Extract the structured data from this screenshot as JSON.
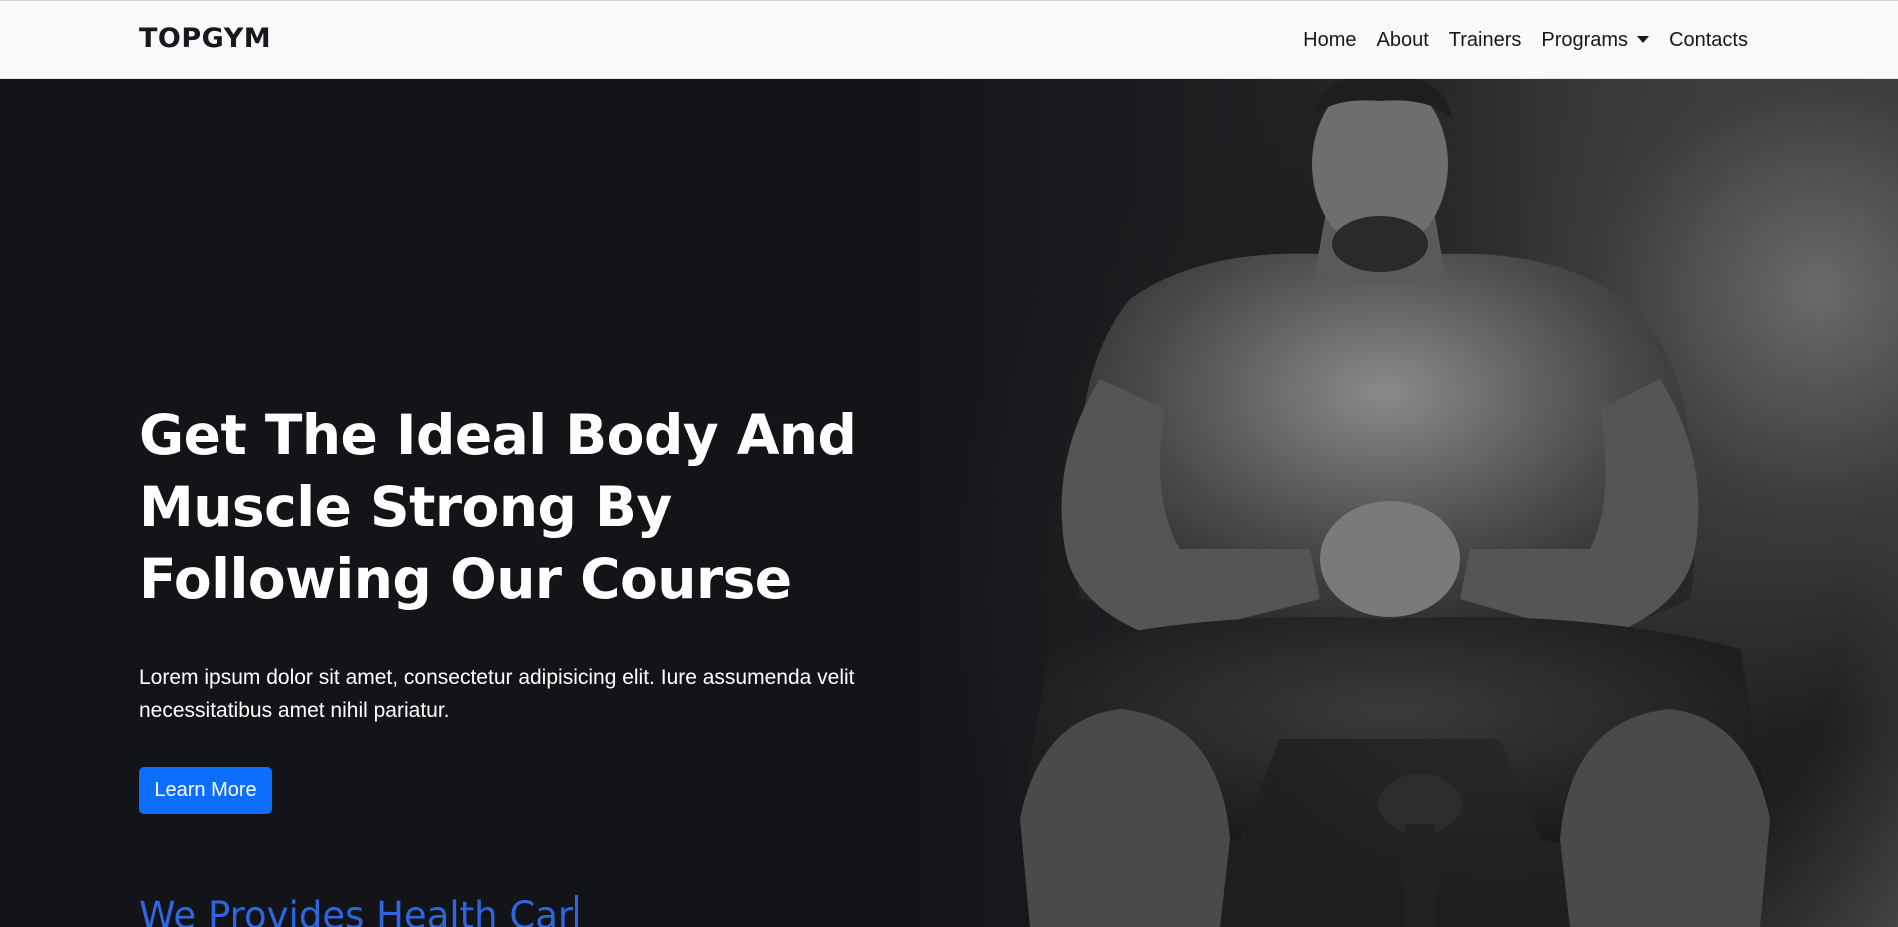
{
  "navbar": {
    "brand": "TOPGYM",
    "links": [
      {
        "label": "Home"
      },
      {
        "label": "About"
      },
      {
        "label": "Trainers"
      },
      {
        "label": "Programs",
        "dropdown": true
      },
      {
        "label": "Contacts"
      }
    ]
  },
  "hero": {
    "headline": "Get The Ideal Body And Muscle Strong By Following Our Course",
    "lead": "Lorem ipsum dolor sit amet, consectetur adipisicing elit. Iure assumenda velit necessitatibus amet nihil pariatur.",
    "button_label": "Learn More",
    "typing_text": "We Provides Health Car",
    "image_subject": "muscular man seated, hands clasped, black and white"
  },
  "colors": {
    "navbar_bg": "#f8f9fa",
    "hero_bg": "#121418",
    "primary": "#0d6efd",
    "typing": "#2f66e0"
  }
}
